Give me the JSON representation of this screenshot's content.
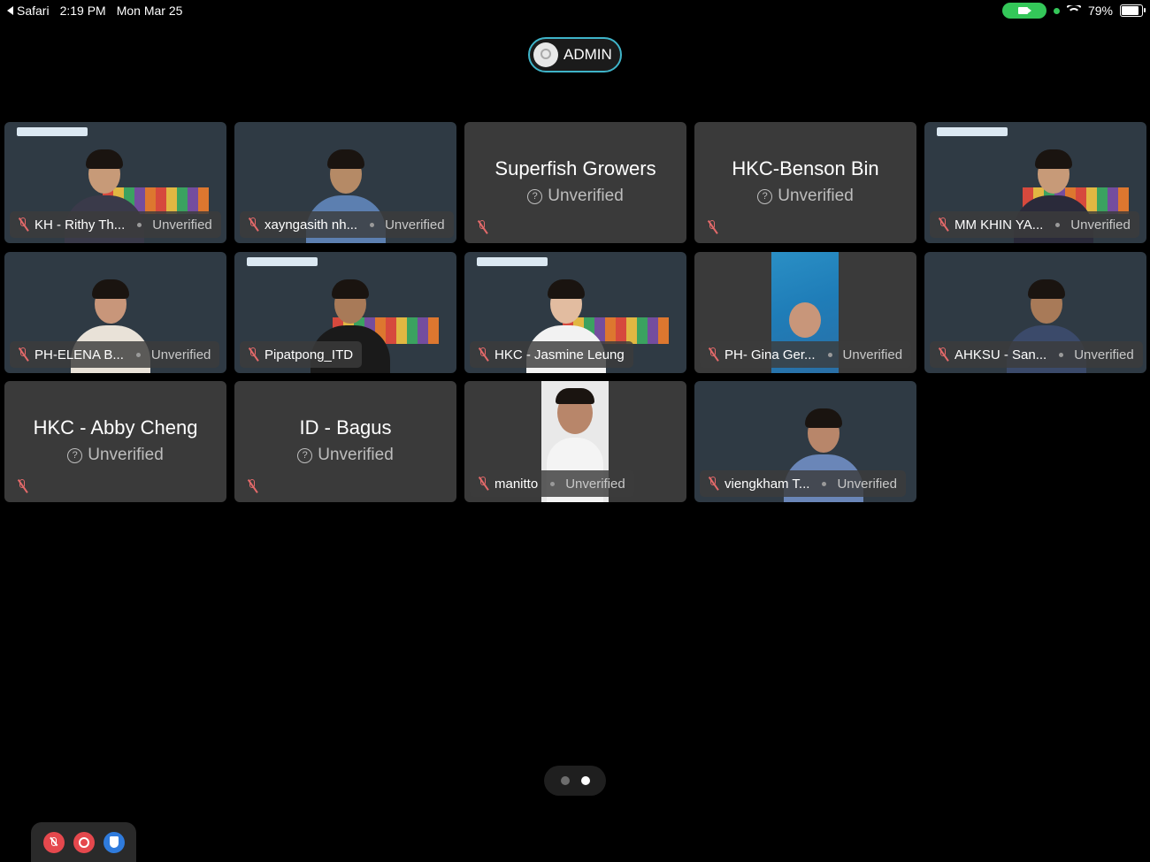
{
  "status_bar": {
    "back_app": "Safari",
    "time": "2:19 PM",
    "date": "Mon Mar 25",
    "battery": "79%"
  },
  "admin_pill": {
    "label": "ADMIN"
  },
  "participants": [
    {
      "name": "KH - Rithy Th...",
      "status": "Unverified"
    },
    {
      "name": "xayngasith nh...",
      "status": "Unverified"
    },
    {
      "name": "Superfish Growers",
      "status": "Unverified"
    },
    {
      "name": "HKC-Benson Bin",
      "status": "Unverified"
    },
    {
      "name": "MM KHIN YA...",
      "status": "Unverified"
    },
    {
      "name": "PH-ELENA B...",
      "status": "Unverified"
    },
    {
      "name": "Pipatpong_ITD",
      "status": ""
    },
    {
      "name": "HKC - Jasmine Leung",
      "status": ""
    },
    {
      "name": "PH- Gina Ger...",
      "status": "Unverified"
    },
    {
      "name": "AHKSU - San...",
      "status": "Unverified"
    },
    {
      "name": "HKC - Abby Cheng",
      "status": "Unverified"
    },
    {
      "name": "ID - Bagus",
      "status": "Unverified"
    },
    {
      "name": "manitto",
      "status": "Unverified"
    },
    {
      "name": "viengkham T...",
      "status": "Unverified"
    }
  ],
  "icons": {
    "mic_off": "mic-off-icon",
    "unverified": "question-circle-icon",
    "record": "record-icon",
    "shield": "shield-icon",
    "camera": "camera-icon"
  },
  "pager": {
    "pages": 2,
    "current": 2
  },
  "colors": {
    "accent": "#3fb4c9",
    "mic_off": "#e46a6a",
    "camera_active": "#34c759"
  }
}
